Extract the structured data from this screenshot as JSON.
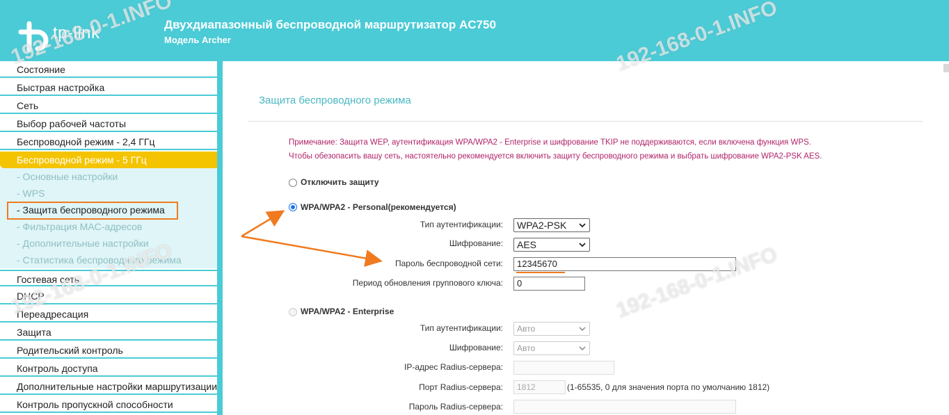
{
  "header": {
    "logo": "tp-link",
    "title": "Двухдиапазонный беспроводной маршрутизатор AC750",
    "subtitle": "Модель Archer"
  },
  "sidebar": {
    "items": [
      {
        "label": "Состояние"
      },
      {
        "label": "Быстрая настройка"
      },
      {
        "label": "Сеть"
      },
      {
        "label": "Выбор рабочей частоты"
      },
      {
        "label": "Беспроводной режим - 2,4 ГГц"
      },
      {
        "label": "Беспроводной режим - 5 ГГц"
      },
      {
        "label": "Гостевая сеть"
      },
      {
        "label": "DHCP"
      },
      {
        "label": "Переадресация"
      },
      {
        "label": "Защита"
      },
      {
        "label": "Родительский контроль"
      },
      {
        "label": "Контроль доступа"
      },
      {
        "label": "Дополнительные настройки маршрутизации"
      },
      {
        "label": "Контроль пропускной способности"
      }
    ],
    "submenu": [
      {
        "label": "- Основные настройки"
      },
      {
        "label": "- WPS"
      },
      {
        "label": "- Защита беспроводного режима"
      },
      {
        "label": "- Фильтрация MAC-адресов"
      },
      {
        "label": "- Дополнительные настройки"
      },
      {
        "label": "- Статистика беспроводного режима"
      }
    ]
  },
  "main": {
    "title": "Защита беспроводного режима",
    "note_line1": "Примечание: Защита WEP, аутентификация WPA/WPA2 - Enterprise и шифрование TKIP не поддерживаются, если включена функция WPS.",
    "note_line2": "Чтобы обезопасить вашу сеть, настоятельно рекомендуется включить защиту беспроводного режима и выбрать шифрование WPA2-PSK AES.",
    "option_disable": "Отключить защиту",
    "option_personal": "WPA/WPA2 - Personal(рекомендуется)",
    "option_enterprise": "WPA/WPA2 - Enterprise",
    "personal": {
      "auth_label": "Тип аутентификации:",
      "auth_value": "WPA2-PSK",
      "enc_label": "Шифрование:",
      "enc_value": "AES",
      "pass_label": "Пароль беспроводной сети:",
      "pass_value": "12345670",
      "group_label": "Период обновления группового ключа:",
      "group_value": "0"
    },
    "enterprise": {
      "auth_label": "Тип аутентификации:",
      "auth_value": "Авто",
      "enc_label": "Шифрование:",
      "enc_value": "Авто",
      "radius_ip_label": "IP-адрес Radius-сервера:",
      "radius_ip_value": "",
      "radius_port_label": "Порт Radius-сервера:",
      "radius_port_value": "1812",
      "radius_port_hint": "(1-65535, 0 для значения порта по умолчанию 1812)",
      "radius_pass_label": "Пароль Radius-сервера:",
      "radius_pass_value": ""
    }
  },
  "watermark": "192-168-0-1.INFO",
  "colors": {
    "header": "#4acbd6",
    "active": "#f5c400",
    "note": "#b0246a",
    "annotation": "#f07a1f"
  }
}
